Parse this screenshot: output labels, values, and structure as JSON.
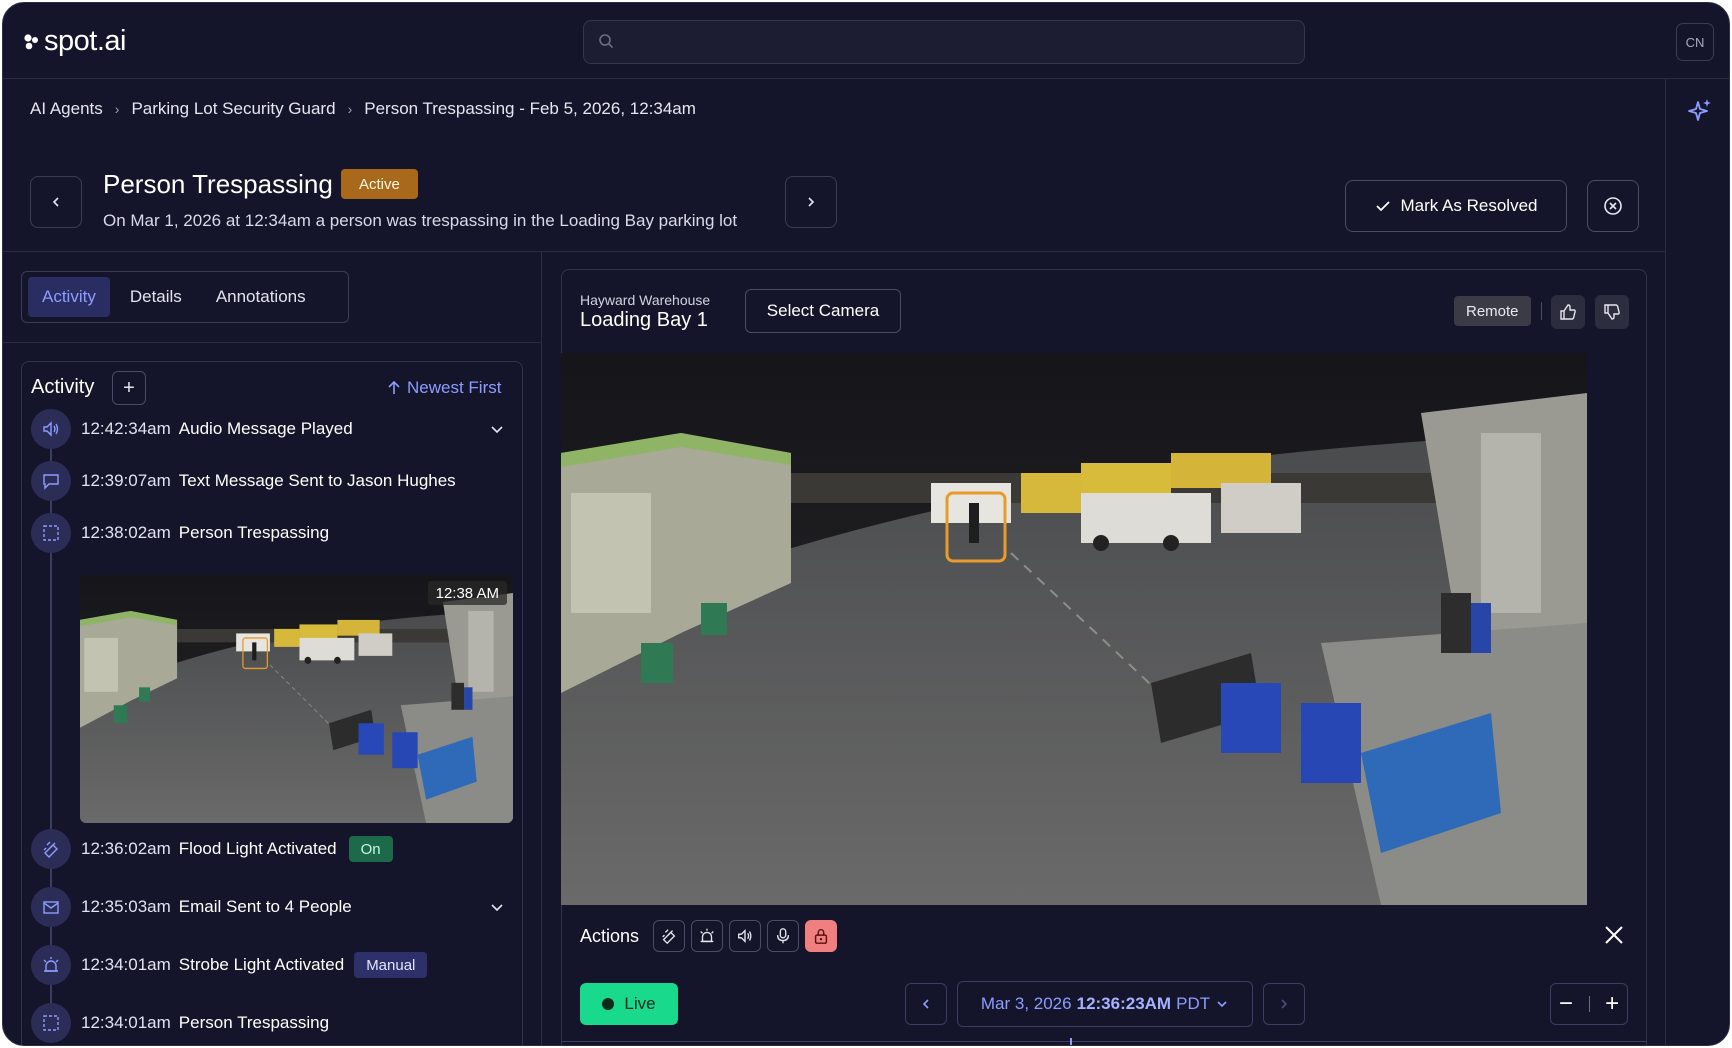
{
  "app": {
    "logo_text": "spot.ai",
    "avatar_initials": "CN",
    "search": {
      "placeholder": ""
    }
  },
  "breadcrumb": [
    "AI Agents",
    "Parking Lot Security Guard",
    "Person Trespassing - Feb 5, 2026, 12:34am"
  ],
  "header": {
    "title": "Person Trespassing",
    "status": "Active",
    "description": "On Mar 1, 2026 at 12:34am a person was trespassing in the Loading Bay parking lot",
    "resolve_label": "Mark As Resolved"
  },
  "tabs": [
    "Activity",
    "Details",
    "Annotations"
  ],
  "activity": {
    "title": "Activity",
    "sort_label": "Newest First",
    "events": [
      {
        "time": "12:42:34am",
        "text": "Audio Message Played",
        "icon": "speaker-icon",
        "expandable": true
      },
      {
        "time": "12:39:07am",
        "text": "Text Message Sent to Jason Hughes",
        "icon": "message-icon"
      },
      {
        "time": "12:38:02am",
        "text": "Person Trespassing",
        "icon": "detection-icon",
        "thumbnail_time": "12:38 AM"
      },
      {
        "time": "12:36:02am",
        "text": "Flood Light Activated",
        "icon": "floodlight-icon",
        "badge": "On"
      },
      {
        "time": "12:35:03am",
        "text": "Email Sent to 4 People",
        "icon": "email-icon",
        "expandable": true
      },
      {
        "time": "12:34:01am",
        "text": "Strobe Light Activated",
        "icon": "strobe-icon",
        "badge": "Manual"
      },
      {
        "time": "12:34:01am",
        "text": "Person Trespassing",
        "icon": "detection-icon"
      }
    ]
  },
  "camera": {
    "site": "Hayward Warehouse",
    "name": "Loading Bay 1",
    "select_label": "Select Camera",
    "mode_badge": "Remote",
    "actions_label": "Actions",
    "action_icons": [
      "floodlight-icon",
      "strobe-icon",
      "speaker-icon",
      "microphone-icon",
      "lock-icon"
    ]
  },
  "playback": {
    "live_label": "Live",
    "date": "Mar 3, 2026",
    "time": "12:36:23AM",
    "timezone": "PDT"
  },
  "colors": {
    "accent": "#8d9cff",
    "active_badge": "#a8691a",
    "live_green": "#18d98c",
    "danger": "#f07f7f",
    "background": "#14152a"
  }
}
